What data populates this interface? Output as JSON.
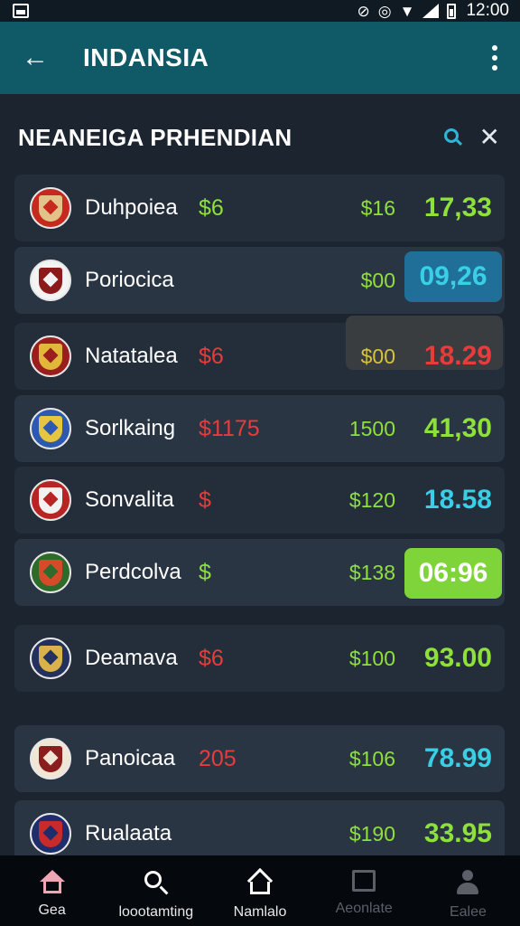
{
  "status_bar": {
    "time": "12:00",
    "icons": [
      "sim-icon",
      "wifi-off-icon",
      "alarm-icon",
      "wifi-icon",
      "signal-icon",
      "battery-icon"
    ]
  },
  "app_bar": {
    "title": "INDANSIA",
    "back_icon": "back-arrow-icon",
    "menu_icon": "more-vertical-icon"
  },
  "section": {
    "title": "NEANEIGA PRHENDIAN",
    "search_icon": "search-icon",
    "close_icon": "close-icon"
  },
  "rows": [
    {
      "name": "Duhpoiea",
      "odd_a": "$6",
      "odd_a_color": "green",
      "odd_b": "$16",
      "odd_c": "17,33",
      "odd_c_color": "green",
      "crest": [
        "#c62a1f",
        "#e2c48b"
      ],
      "highlight": "none"
    },
    {
      "name": "Poriocica",
      "odd_a": "",
      "odd_a_color": "green",
      "odd_b": "$00",
      "odd_c": "09,26",
      "odd_c_color": "cyan",
      "crest": [
        "#f3f3f3",
        "#8c1a1a"
      ],
      "highlight": "cyan-pill"
    },
    {
      "name": "Natatalea",
      "odd_a": "$6",
      "odd_a_color": "red",
      "odd_b": "$00",
      "odd_c": "18.29",
      "odd_c_color": "red",
      "crest": [
        "#9b1e1e",
        "#e2b83a"
      ],
      "highlight": "grey-panel"
    },
    {
      "name": "Sorlkaing",
      "odd_a": "$1175",
      "odd_a_color": "red",
      "odd_b": "1500",
      "odd_c": "41,30",
      "odd_c_color": "green",
      "crest": [
        "#2d5ab0",
        "#e6c640"
      ],
      "highlight": "none"
    },
    {
      "name": "Sonvalita",
      "odd_a": "$",
      "odd_a_color": "red",
      "odd_b": "$120",
      "odd_c": "18.58",
      "odd_c_color": "cyan",
      "crest": [
        "#b82323",
        "#f1f1f1"
      ],
      "highlight": "none"
    },
    {
      "name": "Perdcolva",
      "odd_a": "$",
      "odd_a_color": "green",
      "odd_b": "$138",
      "odd_c": "06:96",
      "odd_c_color": "white",
      "crest": [
        "#2e6b2a",
        "#d64a2a"
      ],
      "highlight": "green-pill"
    },
    {
      "name": "Deamava",
      "odd_a": "$6",
      "odd_a_color": "red",
      "odd_b": "$100",
      "odd_c": "93.00",
      "odd_c_color": "green",
      "crest": [
        "#24305e",
        "#d9b24a"
      ],
      "highlight": "none"
    },
    {
      "name": "Panoicaa",
      "odd_a": "205",
      "odd_a_color": "red",
      "odd_b": "$106",
      "odd_c": "78.99",
      "odd_c_color": "cyan",
      "crest": [
        "#f0e6d6",
        "#8a1d1d"
      ],
      "highlight": "none"
    },
    {
      "name": "Rualaata",
      "odd_a": "",
      "odd_a_color": "green",
      "odd_b": "$190",
      "odd_c": "33.95",
      "odd_c_color": "green",
      "crest": [
        "#1f2d6b",
        "#c92a2a"
      ],
      "highlight": "none"
    }
  ],
  "bottom_nav": [
    {
      "label": "Gea",
      "icon": "home-icon",
      "active": true
    },
    {
      "label": "loootamting",
      "icon": "search-icon",
      "active": true
    },
    {
      "label": "Namlalo",
      "icon": "home-outline-icon",
      "active": true
    },
    {
      "label": "Aeonlate",
      "icon": "square-icon",
      "active": false
    },
    {
      "label": "Ealee",
      "icon": "person-icon",
      "active": false
    }
  ],
  "colors": {
    "background": "#1c2430",
    "app_bar": "#0f5a66",
    "row": "#2a3544",
    "green": "#8ee03a",
    "red": "#e83b3b",
    "cyan": "#39cfe6",
    "nav_background": "#05080c"
  }
}
